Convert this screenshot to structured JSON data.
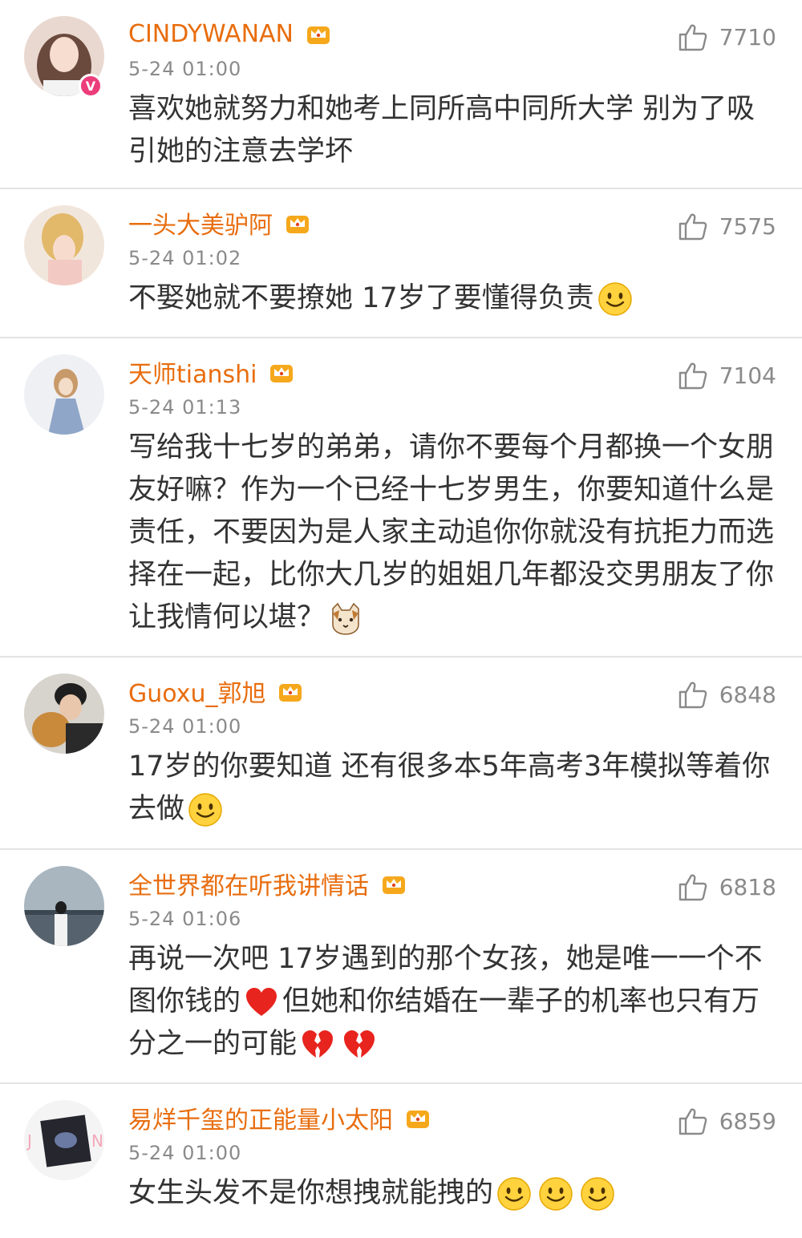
{
  "comments": [
    {
      "username": "CINDYWANAN",
      "time": "5-24 01:00",
      "likes": "7710",
      "text": "喜欢她就努力和她考上同所高中同所大学 别为了吸引她的注意去学坏",
      "emojis": [],
      "verified_badge": "V",
      "avatar_icon": "girl-portrait-avatar"
    },
    {
      "username": "一头大美驴阿",
      "time": "5-24 01:02",
      "likes": "7575",
      "text": "不娶她就不要撩她 17岁了要懂得负责",
      "emojis": [
        "smile-emoji"
      ],
      "avatar_icon": "anime-girl-avatar"
    },
    {
      "username": "天师tianshi",
      "time": "5-24 01:13",
      "likes": "7104",
      "text": "写给我十七岁的弟弟，请你不要每个月都换一个女朋友好嘛？作为一个已经十七岁男生，你要知道什么是责任，不要因为是人家主动追你你就没有抗拒力而选择在一起，比你大几岁的姐姐几年都没交男朋友了你让我情何以堪？",
      "emojis": [
        "cat-emoji"
      ],
      "avatar_icon": "illustration-avatar"
    },
    {
      "username": "Guoxu_郭旭",
      "time": "5-24 01:00",
      "likes": "6848",
      "text": "17岁的你要知道 还有很多本5年高考3年模拟等着你去做",
      "emojis": [
        "smile-emoji"
      ],
      "avatar_icon": "man-with-dog-avatar"
    },
    {
      "username": "全世界都在听我讲情话",
      "time": "5-24 01:06",
      "likes": "6818",
      "text_parts": [
        "再说一次吧 17岁遇到的那个女孩，她是唯一一个不图你钱的",
        "但她和你结婚在一辈子的机率也只有万分之一的可能"
      ],
      "emojis": [
        "heart-emoji",
        "broken-heart-emoji",
        "broken-heart-emoji"
      ],
      "avatar_icon": "seaside-avatar"
    },
    {
      "username": "易烊千玺的正能量小太阳",
      "time": "5-24 01:00",
      "likes": "6859",
      "text": "女生头发不是你想拽就能拽的",
      "emojis": [
        "smile-emoji",
        "smile-emoji",
        "smile-emoji"
      ],
      "avatar_icon": "photo-card-avatar"
    }
  ],
  "colors": {
    "username": "#e86d0e",
    "meta": "#8a8a8a",
    "text": "#333333",
    "divider": "#e3e3e3",
    "crown": "#f6a81c"
  }
}
